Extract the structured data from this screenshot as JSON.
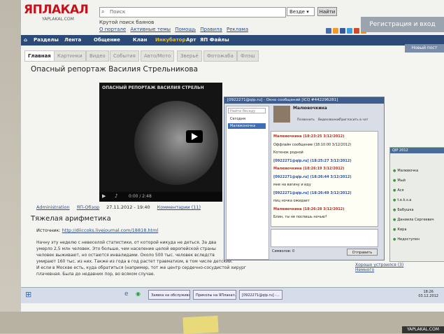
{
  "header": {
    "logo": "ЯПЛАКАЛ",
    "logo_sub": "YAPLAKAL.COM",
    "search_placeholder": "Поиск",
    "search_scope": "Везде",
    "search_button": "Найти",
    "tagline": "Крутой поиск баянов",
    "links": [
      "О портале",
      "Активные темы",
      "Помощь",
      "Правила",
      "Реклама"
    ],
    "register": "Регистрация и вход"
  },
  "nav": {
    "items": [
      "Разделы",
      "Лента",
      "Общение",
      "Клан",
      "Инкубатор",
      "Арт",
      "ЯП Файлы"
    ],
    "new_post": "Новый пост"
  },
  "tabs": [
    "Главная",
    "Картинки",
    "Видео",
    "События",
    "Авто/Мото",
    "Зверьё",
    "Фотожаба",
    "Флэш"
  ],
  "post1": {
    "title": "Опасный репортаж Василия Стрельникова",
    "video_title": "ОПАСНЫЙ РЕПОРТАЖ ВАСИЛИЯ СТРЕЛЬН",
    "video_time": "0:00 / 2:48",
    "author": "Administration",
    "section": "ЯП-Обзор",
    "date": "27.11.2012 - 19:40",
    "comments": "Комментарии (11)"
  },
  "post2": {
    "title": "Тяжелая арифметика",
    "source_label": "Источник:",
    "source_url": "http://diiccoks.livejournal.com/18818.html",
    "lines": [
      "Начну эту неделю с невеселой статистики, от которой никуда не деться. За два",
      "умерло 2,5 млн человек. Это больше, чем население целой европейской страны",
      "человек выживают, но остаются инвалидами. Около 500 тыс. человек вследств",
      "умирают 160 тыс. из них. Также из года в год растет травматизм, в том числе детский.",
      "И если в Москве есть, куда обратиться (например, тот же центр сердечно-сосудистой хирургии Бакулева), то в регионах ситуация",
      "плачевная. Была до недавних пор, во всяком случае."
    ]
  },
  "chat": {
    "title": "[0922271@qip.ru] - Окно сообщений [ICQ #442296281]",
    "find_placeholder": "Найти беседу",
    "contacts": [
      "Сегодня",
      "Малюконочка"
    ],
    "contact_name": "Малювочкина",
    "tools": [
      "Позвонить",
      "Видеозвонок",
      "Пригласить в чат"
    ],
    "messages": [
      {
        "from": "Малювочкина (18:23:25 3/12/2012)",
        "kind": "h"
      },
      {
        "text": "Оффлайн сообщение (18:10:00 3/12/2012)",
        "kind": "t"
      },
      {
        "text": "Котенок родной",
        "kind": "t"
      },
      {
        "from": "[0922271@qip.ru] (18:25:27 3/12/2012)",
        "kind": "b"
      },
      {
        "from": "Малювочкина (18:26:19 3/12/2012)",
        "kind": "h"
      },
      {
        "from": "[0922271@qip.ru] (18:26:44 3/12/2012)",
        "kind": "b"
      },
      {
        "text": "мне на вагину и иду",
        "kind": "t"
      },
      {
        "from": "[0922271@qip.ru] (18:26:49 3/12/2012)",
        "kind": "b"
      },
      {
        "text": "пиц ночка ожидает",
        "kind": "t"
      },
      {
        "from": "Малювочкина (18:26:28 3/12/2012)",
        "kind": "h"
      },
      {
        "text": "Блин, ты не поспишь ночью?",
        "kind": "t"
      }
    ],
    "chars": "Символов: 0",
    "send": "Отправить"
  },
  "icq": {
    "title": "QIP 2012",
    "items": [
      "Малювочка",
      "Мый",
      "Ася",
      "t.e.k.s.a",
      "Бабушка",
      "Даниила Сергеевич",
      "Кира",
      "Недоступен"
    ]
  },
  "sidebar_links": [
    "Хорошо устроился (3)",
    "Немного"
  ],
  "taskbar": {
    "buttons": [
      "Заявка на обслуживан...",
      "Приколы на ЯПлакал...",
      "[0922271@qip.ru] -..."
    ],
    "time": "18:26",
    "date": "03.12.2012"
  },
  "watermark": "YAPLAKAL.COM",
  "colors": {
    "brand_red": "#c3121b",
    "nav_blue": "#2b4a78",
    "link": "#2a4c8a"
  }
}
